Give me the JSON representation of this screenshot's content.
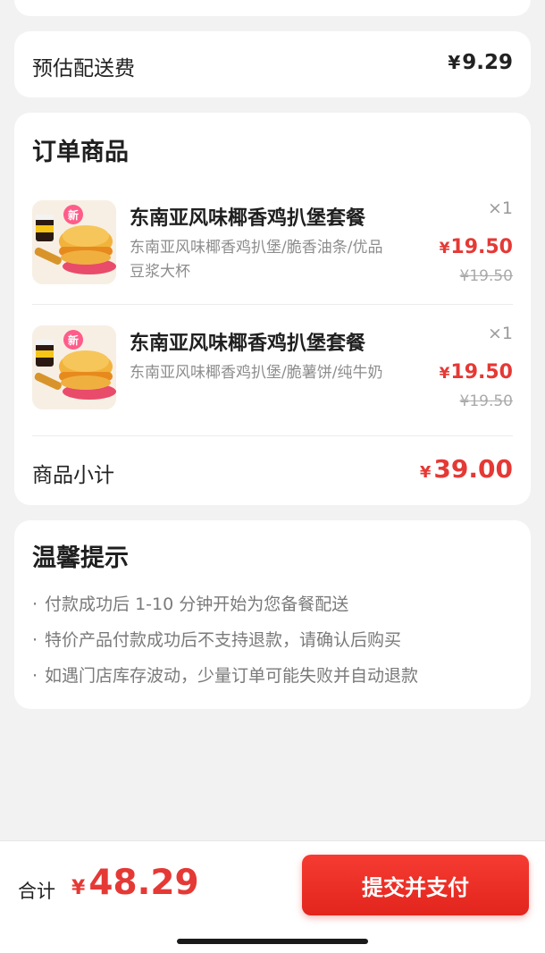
{
  "delivery": {
    "label": "预估配送费",
    "currency": "¥",
    "value": "9.29"
  },
  "order": {
    "title": "订单商品",
    "items": [
      {
        "name": "东南亚风味椰香鸡扒堡套餐",
        "description": "东南亚风味椰香鸡扒堡/脆香油条/优品豆浆大杯",
        "quantity": "×1",
        "currency": "¥",
        "price": "19.50",
        "original_price": "¥19.50",
        "badge": "新"
      },
      {
        "name": "东南亚风味椰香鸡扒堡套餐",
        "description": "东南亚风味椰香鸡扒堡/脆薯饼/纯牛奶",
        "quantity": "×1",
        "currency": "¥",
        "price": "19.50",
        "original_price": "¥19.50",
        "badge": "新"
      }
    ],
    "subtotal_label": "商品小计",
    "subtotal_currency": "¥",
    "subtotal_value": "39.00"
  },
  "tips": {
    "title": "温馨提示",
    "bullet": "·",
    "items": [
      "付款成功后 1-10 分钟开始为您备餐配送",
      "特价产品付款成功后不支持退款，请确认后购买",
      "如遇门店库存波动，少量订单可能失败并自动退款"
    ]
  },
  "footer": {
    "total_label": "合计",
    "total_currency": "¥",
    "total_value": "48.29",
    "submit_label": "提交并支付"
  },
  "colors": {
    "accent_red": "#e53935",
    "background": "#f2f2f2",
    "card": "#ffffff"
  }
}
